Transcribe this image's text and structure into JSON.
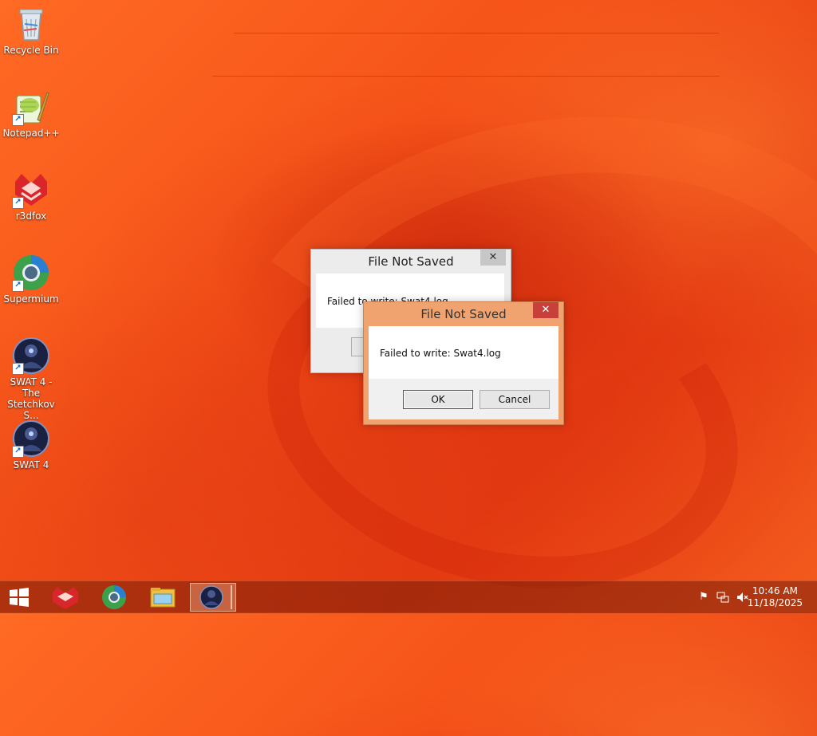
{
  "desktop": {
    "icons": [
      {
        "label": "Recycle Bin",
        "icon": "recycle-bin-icon"
      },
      {
        "label": "Notepad++",
        "icon": "notepad-plus-plus-icon"
      },
      {
        "label": "r3dfox",
        "icon": "r3dfox-icon"
      },
      {
        "label": "Supermium",
        "icon": "supermium-icon"
      },
      {
        "label": "SWAT 4 - The Stetchkov S...",
        "icon": "swat4-stetchkov-icon"
      },
      {
        "label": "SWAT 4",
        "icon": "swat4-icon"
      }
    ]
  },
  "dialog_back": {
    "title": "File Not Saved",
    "message": "Failed to write: Swat4.log",
    "close_glyph": "✕"
  },
  "dialog_front": {
    "title": "File Not Saved",
    "message": "Failed to write: Swat4.log",
    "ok_label": "OK",
    "cancel_label": "Cancel",
    "close_glyph": "✕"
  },
  "taskbar": {
    "start_icon": "windows-start-icon",
    "pinned": [
      "r3dfox-icon",
      "supermium-icon",
      "file-explorer-icon",
      "swat4-icon"
    ],
    "active_item": "swat4-icon",
    "tray": [
      "action-center-flag-icon",
      "network-icon",
      "volume-muted-icon"
    ],
    "time": "10:46 AM",
    "date": "11/18/2025"
  },
  "colors": {
    "accent": "#f04e1a",
    "close_button": "#c8403a"
  }
}
